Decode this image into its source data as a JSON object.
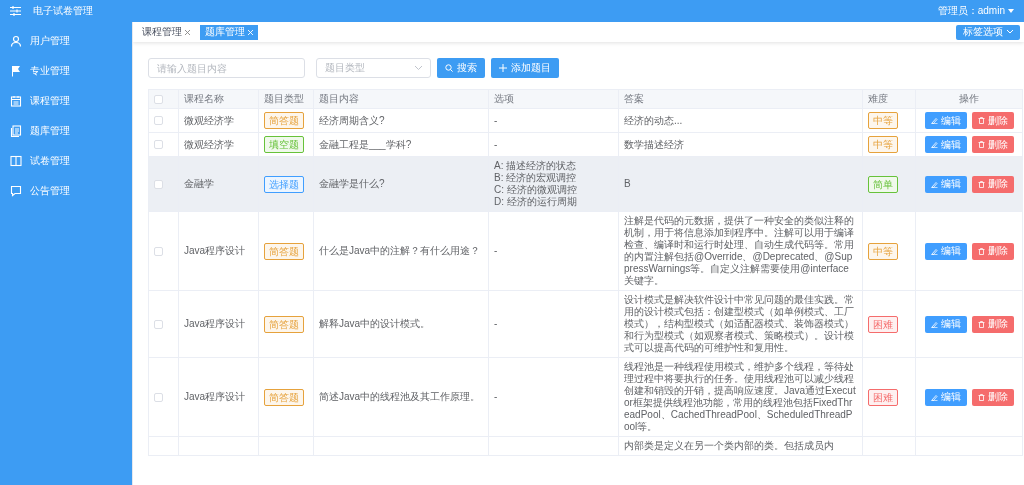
{
  "header": {
    "title": "电子试卷管理",
    "user": "管理员：admin"
  },
  "sidebar": {
    "items": [
      {
        "label": "用户管理"
      },
      {
        "label": "专业管理"
      },
      {
        "label": "课程管理"
      },
      {
        "label": "题库管理"
      },
      {
        "label": "试卷管理"
      },
      {
        "label": "公告管理"
      }
    ]
  },
  "tabs": [
    {
      "label": "课程管理",
      "selected": false
    },
    {
      "label": "题库管理",
      "selected": true
    }
  ],
  "tab_options": "标签选项",
  "toolbar": {
    "search_placeholder": "请输入题目内容",
    "type_placeholder": "题目类型",
    "search_button": "搜索",
    "add_button": "添加题目"
  },
  "table": {
    "header_checked": false,
    "columns": [
      "课程名称",
      "题目类型",
      "题目内容",
      "选项",
      "答案",
      "难度",
      "操作"
    ],
    "rows": [
      {
        "checked": false,
        "highlighted": false,
        "course": "微观经济学",
        "type": {
          "text": "简答题",
          "color": "#e6a23c"
        },
        "content": "经济周期含义?",
        "options": [
          "-"
        ],
        "answer": "经济的动态...",
        "difficulty": {
          "text": "中等",
          "color": "#e6a23c"
        },
        "actions": [
          {
            "label": "编辑",
            "kind": "edit"
          },
          {
            "label": "删除",
            "kind": "delete"
          }
        ]
      },
      {
        "checked": false,
        "highlighted": false,
        "course": "微观经济学",
        "type": {
          "text": "填空题",
          "color": "#67c23a"
        },
        "content": "金融工程是___学科?",
        "options": [
          "-"
        ],
        "answer": "数学描述经济",
        "difficulty": {
          "text": "中等",
          "color": "#e6a23c"
        },
        "actions": [
          {
            "label": "编辑",
            "kind": "edit"
          },
          {
            "label": "删除",
            "kind": "delete"
          }
        ]
      },
      {
        "checked": false,
        "highlighted": true,
        "course": "金融学",
        "type": {
          "text": "选择题",
          "color": "#409eff"
        },
        "content": "金融学是什么?",
        "options": [
          "A: 描述经济的状态",
          "B: 经济的宏观调控",
          "C: 经济的微观调控",
          "D: 经济的运行周期"
        ],
        "answer": "B",
        "difficulty": {
          "text": "简单",
          "color": "#67c23a"
        },
        "actions": [
          {
            "label": "编辑",
            "kind": "edit"
          },
          {
            "label": "删除",
            "kind": "delete"
          }
        ]
      },
      {
        "checked": false,
        "highlighted": false,
        "course": "Java程序设计",
        "type": {
          "text": "简答题",
          "color": "#e6a23c"
        },
        "content": "什么是Java中的注解？有什么用途？",
        "options": [
          "-"
        ],
        "answer": "注解是代码的元数据，提供了一种安全的类似注释的机制，用于将信息添加到程序中。注解可以用于编译检查、编译时和运行时处理、自动生成代码等。常用的内置注解包括@Override、@Deprecated、@SuppressWarnings等。自定义注解需要使用@interface关键字。",
        "difficulty": {
          "text": "中等",
          "color": "#e6a23c"
        },
        "actions": [
          {
            "label": "编辑",
            "kind": "edit"
          },
          {
            "label": "删除",
            "kind": "delete"
          }
        ]
      },
      {
        "checked": false,
        "highlighted": false,
        "course": "Java程序设计",
        "type": {
          "text": "简答题",
          "color": "#e6a23c"
        },
        "content": "解释Java中的设计模式。",
        "options": [
          "-"
        ],
        "answer": "设计模式是解决软件设计中常见问题的最佳实践。常用的设计模式包括：创建型模式（如单例模式、工厂模式），结构型模式（如适配器模式、装饰器模式）和行为型模式（如观察者模式、策略模式）。设计模式可以提高代码的可维护性和复用性。",
        "difficulty": {
          "text": "困难",
          "color": "#f56c6c"
        },
        "actions": [
          {
            "label": "编辑",
            "kind": "edit"
          },
          {
            "label": "删除",
            "kind": "delete"
          }
        ]
      },
      {
        "checked": false,
        "highlighted": false,
        "course": "Java程序设计",
        "type": {
          "text": "简答题",
          "color": "#e6a23c"
        },
        "content": "简述Java中的线程池及其工作原理。",
        "options": [
          "-"
        ],
        "answer": "线程池是一种线程使用模式，维护多个线程，等待处理过程中将要执行的任务。使用线程池可以减少线程创建和销毁的开销，提高响应速度。Java通过Executor框架提供线程池功能，常用的线程池包括FixedThreadPool、CachedThreadPool、ScheduledThreadPool等。",
        "difficulty": {
          "text": "困难",
          "color": "#f56c6c"
        },
        "actions": [
          {
            "label": "编辑",
            "kind": "edit"
          },
          {
            "label": "删除",
            "kind": "delete"
          }
        ]
      },
      {
        "answer": "内部类是定义在另一个类内部的类。包括成员内"
      }
    ]
  }
}
